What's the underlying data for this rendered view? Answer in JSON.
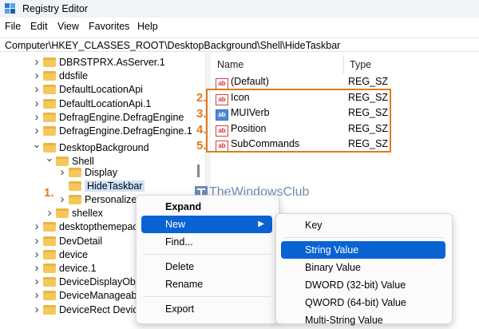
{
  "window": {
    "title": "Registry Editor"
  },
  "menu": [
    "File",
    "Edit",
    "View",
    "Favorites",
    "Help"
  ],
  "address": "Computer\\HKEY_CLASSES_ROOT\\DesktopBackground\\Shell\\HideTaskbar",
  "tree": {
    "items": [
      {
        "label": "DBRSTPRX.AsServer.1",
        "level": 0,
        "expander": "collapsed"
      },
      {
        "label": "ddsfile",
        "level": 0,
        "expander": "collapsed"
      },
      {
        "label": "DefaultLocationApi",
        "level": 0,
        "expander": "collapsed"
      },
      {
        "label": "DefaultLocationApi.1",
        "level": 0,
        "expander": "collapsed"
      },
      {
        "label": "DefragEngine.DefragEngine",
        "level": 0,
        "expander": "collapsed"
      },
      {
        "label": "DefragEngine.DefragEngine.1",
        "level": 0,
        "expander": "collapsed"
      },
      {
        "label": "DesktopBackground",
        "level": 0,
        "expander": "expanded"
      },
      {
        "label": "Shell",
        "level": 1,
        "expander": "expanded"
      },
      {
        "label": "Display",
        "level": 2,
        "expander": "collapsed"
      },
      {
        "label": "HideTaskbar",
        "level": 2,
        "expander": "none",
        "selected": true
      },
      {
        "label": "Personalize",
        "level": 2,
        "expander": "collapsed"
      },
      {
        "label": "shellex",
        "level": 1,
        "expander": "collapsed"
      },
      {
        "label": "desktopthemepac",
        "level": 0,
        "expander": "collapsed"
      },
      {
        "label": "DevDetail",
        "level": 0,
        "expander": "collapsed"
      },
      {
        "label": "device",
        "level": 0,
        "expander": "collapsed"
      },
      {
        "label": "device.1",
        "level": 0,
        "expander": "collapsed"
      },
      {
        "label": "DeviceDisplayObje",
        "level": 0,
        "expander": "collapsed"
      },
      {
        "label": "DeviceManageabil",
        "level": 0,
        "expander": "collapsed"
      },
      {
        "label": "DeviceRect Device",
        "level": 0,
        "expander": "collapsed"
      }
    ]
  },
  "list": {
    "columns": {
      "name": "Name",
      "type": "Type"
    },
    "rows": [
      {
        "name": "(Default)",
        "type": "REG_SZ",
        "icon": "ab"
      },
      {
        "name": "Icon",
        "type": "REG_SZ",
        "icon": "ab"
      },
      {
        "name": "MUIVerb",
        "type": "REG_SZ",
        "icon": "bin"
      },
      {
        "name": "Position",
        "type": "REG_SZ",
        "icon": "ab"
      },
      {
        "name": "SubCommands",
        "type": "REG_SZ",
        "icon": "ab"
      }
    ]
  },
  "annotations": {
    "n1": "1.",
    "n2": "2.",
    "n3": "3.",
    "n4": "4.",
    "n5": "5."
  },
  "watermark": "TheWindowsClub",
  "context_menu": {
    "expand": "Expand",
    "new": "New",
    "find": "Find...",
    "delete": "Delete",
    "rename": "Rename",
    "export": "Export"
  },
  "submenu": {
    "key": "Key",
    "string": "String Value",
    "binary": "Binary Value",
    "dword": "DWORD (32-bit) Value",
    "qword": "QWORD (64-bit) Value",
    "multi": "Multi-String Value"
  },
  "ab_glyph": "ab",
  "bin_glyph": "ab",
  "colors": {
    "annotation": "#e07b1e",
    "menu_highlight": "#0a63d2",
    "folder": "#f5c85b"
  }
}
